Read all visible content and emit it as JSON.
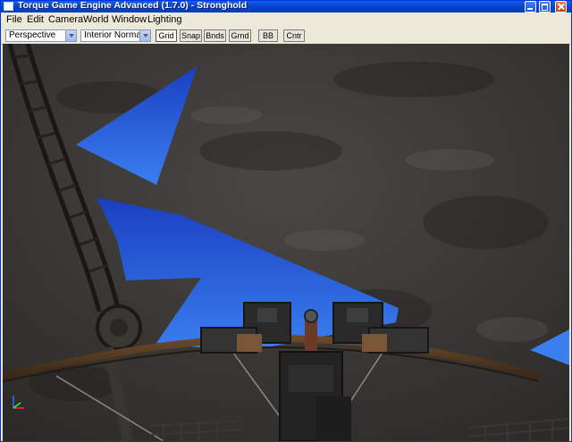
{
  "window": {
    "title": "Torque Game Engine Advanced (1.7.0) - Stronghold"
  },
  "menu": {
    "items": [
      "File",
      "Edit",
      "Camera",
      "World",
      "Window",
      "Lighting"
    ]
  },
  "toolbar": {
    "camera_mode": "Perspective",
    "render_mode": "Interior Normal",
    "buttons": [
      "Grid",
      "Snap",
      "Bnds",
      "Grnd",
      "BB",
      "Cntr"
    ]
  },
  "colors": {
    "title_blue": "#0a3fc2",
    "sky_blue": "#1e4fd8",
    "rock": "#3a3836"
  },
  "icons": [
    "window-app-icon",
    "minimize-icon",
    "maximize-icon",
    "close-icon",
    "axis-gizmo-icon"
  ]
}
